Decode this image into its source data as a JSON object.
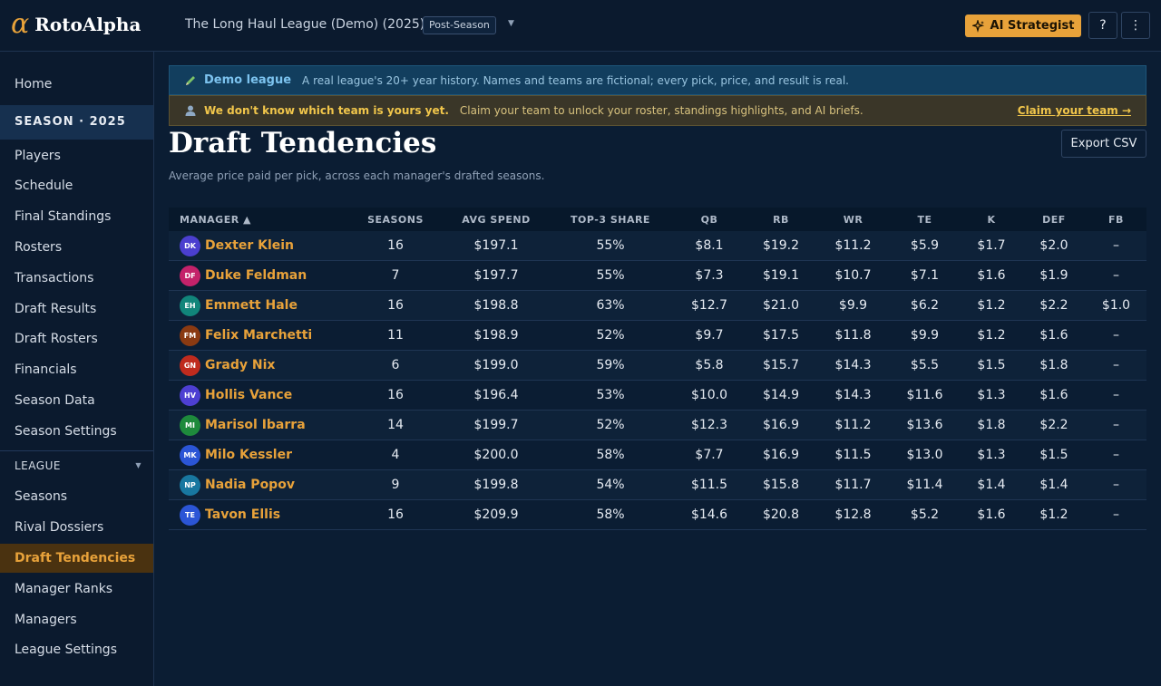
{
  "app": {
    "logo_glyph": "α",
    "name": "RotoAlpha",
    "league_name": "The Long Haul League (Demo) (2025)",
    "phase": "Post-Season",
    "ai_button": "AI Strategist",
    "help_label": "?",
    "more_label": "⋮"
  },
  "sidebar": {
    "home": "Home",
    "season_header": "SEASON · 2025",
    "season_items": [
      "Players",
      "Schedule",
      "Final Standings",
      "Rosters",
      "Transactions",
      "Draft Results",
      "Draft Rosters",
      "Financials",
      "Season Data",
      "Season Settings"
    ],
    "league_header": "LEAGUE",
    "league_items": [
      "Seasons",
      "Rival Dossiers",
      "Draft Tendencies",
      "Manager Ranks",
      "Managers",
      "League Settings"
    ],
    "active_item": "Draft Tendencies"
  },
  "banners": {
    "demo_title": "Demo league",
    "demo_text": "A real league's 20+ year history. Names and teams are fictional; every pick, price, and result is real.",
    "claim_title": "We don't know which team is yours yet.",
    "claim_text": "Claim your team to unlock your roster, standings highlights, and AI briefs.",
    "claim_link": "Claim your team →"
  },
  "page": {
    "title": "Draft Tendencies",
    "subtitle": "Average price paid per pick, across each manager's drafted seasons.",
    "export_button": "Export CSV"
  },
  "table": {
    "columns": [
      "MANAGER ▲",
      "SEASONS",
      "AVG SPEND",
      "TOP-3 SHARE",
      "QB",
      "RB",
      "WR",
      "TE",
      "K",
      "DEF",
      "FB"
    ],
    "rows": [
      {
        "initials": "DK",
        "color": "#4b3fcf",
        "manager": "Dexter Klein",
        "seasons": "16",
        "avg": "$197.1",
        "top3": "55%",
        "qb": "$8.1",
        "rb": "$19.2",
        "wr": "$11.2",
        "te": "$5.9",
        "k": "$1.7",
        "def": "$2.0",
        "fb": "–"
      },
      {
        "initials": "DF",
        "color": "#c4226a",
        "manager": "Duke Feldman",
        "seasons": "7",
        "avg": "$197.7",
        "top3": "55%",
        "qb": "$7.3",
        "rb": "$19.1",
        "wr": "$10.7",
        "te": "$7.1",
        "k": "$1.6",
        "def": "$1.9",
        "fb": "–"
      },
      {
        "initials": "EH",
        "color": "#11857a",
        "manager": "Emmett Hale",
        "seasons": "16",
        "avg": "$198.8",
        "top3": "63%",
        "qb": "$12.7",
        "rb": "$21.0",
        "wr": "$9.9",
        "te": "$6.2",
        "k": "$1.2",
        "def": "$2.2",
        "fb": "$1.0"
      },
      {
        "initials": "FM",
        "color": "#8a3a12",
        "manager": "Felix Marchetti",
        "seasons": "11",
        "avg": "$198.9",
        "top3": "52%",
        "qb": "$9.7",
        "rb": "$17.5",
        "wr": "$11.8",
        "te": "$9.9",
        "k": "$1.2",
        "def": "$1.6",
        "fb": "–"
      },
      {
        "initials": "GN",
        "color": "#bf2b1e",
        "manager": "Grady Nix",
        "seasons": "6",
        "avg": "$199.0",
        "top3": "59%",
        "qb": "$5.8",
        "rb": "$15.7",
        "wr": "$14.3",
        "te": "$5.5",
        "k": "$1.5",
        "def": "$1.8",
        "fb": "–"
      },
      {
        "initials": "HV",
        "color": "#4d3fd2",
        "manager": "Hollis Vance",
        "seasons": "16",
        "avg": "$196.4",
        "top3": "53%",
        "qb": "$10.0",
        "rb": "$14.9",
        "wr": "$14.3",
        "te": "$11.6",
        "k": "$1.3",
        "def": "$1.6",
        "fb": "–"
      },
      {
        "initials": "MI",
        "color": "#1e8a3c",
        "manager": "Marisol Ibarra",
        "seasons": "14",
        "avg": "$199.7",
        "top3": "52%",
        "qb": "$12.3",
        "rb": "$16.9",
        "wr": "$11.2",
        "te": "$13.6",
        "k": "$1.8",
        "def": "$2.2",
        "fb": "–"
      },
      {
        "initials": "MK",
        "color": "#2b55d6",
        "manager": "Milo Kessler",
        "seasons": "4",
        "avg": "$200.0",
        "top3": "58%",
        "qb": "$7.7",
        "rb": "$16.9",
        "wr": "$11.5",
        "te": "$13.0",
        "k": "$1.3",
        "def": "$1.5",
        "fb": "–"
      },
      {
        "initials": "NP",
        "color": "#1877a0",
        "manager": "Nadia Popov",
        "seasons": "9",
        "avg": "$199.8",
        "top3": "54%",
        "qb": "$11.5",
        "rb": "$15.8",
        "wr": "$11.7",
        "te": "$11.4",
        "k": "$1.4",
        "def": "$1.4",
        "fb": "–"
      },
      {
        "initials": "TE",
        "color": "#2b55d6",
        "manager": "Tavon Ellis",
        "seasons": "16",
        "avg": "$209.9",
        "top3": "58%",
        "qb": "$14.6",
        "rb": "$20.8",
        "wr": "$12.8",
        "te": "$5.2",
        "k": "$1.6",
        "def": "$1.2",
        "fb": "–"
      }
    ]
  }
}
